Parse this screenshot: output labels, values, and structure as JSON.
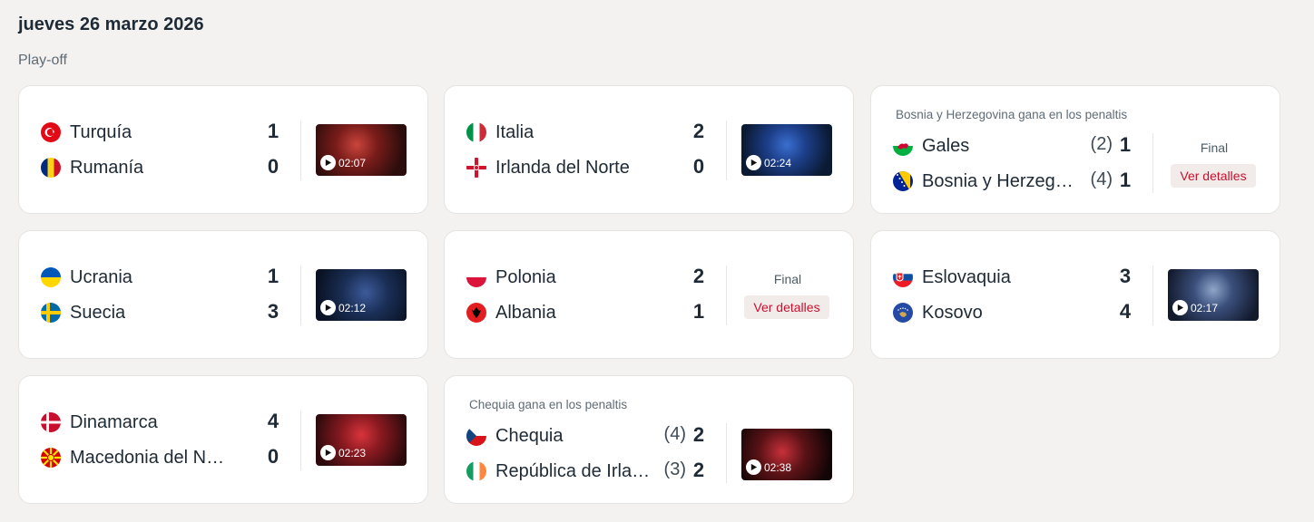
{
  "header": {
    "date": "jueves 26 marzo 2026",
    "stage": "Play-off"
  },
  "matches": [
    {
      "note": "",
      "home": {
        "name": "Turquía",
        "score": "1",
        "pens": "",
        "flag": "turkey-flag"
      },
      "away": {
        "name": "Rumanía",
        "score": "0",
        "pens": "",
        "flag": "romania-flag"
      },
      "video_duration": "02:07",
      "status": "",
      "details_label": ""
    },
    {
      "note": "",
      "home": {
        "name": "Italia",
        "score": "2",
        "pens": "",
        "flag": "italy-flag"
      },
      "away": {
        "name": "Irlanda del Norte",
        "score": "0",
        "pens": "",
        "flag": "northern-ireland-flag"
      },
      "video_duration": "02:24",
      "status": "",
      "details_label": ""
    },
    {
      "note": "Bosnia y Herzegovina gana en los penaltis",
      "home": {
        "name": "Gales",
        "score": "1",
        "pens": "(2)",
        "flag": "wales-flag"
      },
      "away": {
        "name": "Bosnia y Herzegovina",
        "score": "1",
        "pens": "(4)",
        "flag": "bosnia-flag"
      },
      "video_duration": "",
      "status": "Final",
      "details_label": "Ver detalles"
    },
    {
      "note": "",
      "home": {
        "name": "Ucrania",
        "score": "1",
        "pens": "",
        "flag": "ukraine-flag"
      },
      "away": {
        "name": "Suecia",
        "score": "3",
        "pens": "",
        "flag": "sweden-flag"
      },
      "video_duration": "02:12",
      "status": "",
      "details_label": ""
    },
    {
      "note": "",
      "home": {
        "name": "Polonia",
        "score": "2",
        "pens": "",
        "flag": "poland-flag"
      },
      "away": {
        "name": "Albania",
        "score": "1",
        "pens": "",
        "flag": "albania-flag"
      },
      "video_duration": "",
      "status": "Final",
      "details_label": "Ver detalles"
    },
    {
      "note": "",
      "home": {
        "name": "Eslovaquia",
        "score": "3",
        "pens": "",
        "flag": "slovakia-flag"
      },
      "away": {
        "name": "Kosovo",
        "score": "4",
        "pens": "",
        "flag": "kosovo-flag"
      },
      "video_duration": "02:17",
      "status": "",
      "details_label": ""
    },
    {
      "note": "",
      "home": {
        "name": "Dinamarca",
        "score": "4",
        "pens": "",
        "flag": "denmark-flag"
      },
      "away": {
        "name": "Macedonia del Norte",
        "score": "0",
        "pens": "",
        "flag": "north-macedonia-flag"
      },
      "video_duration": "02:23",
      "status": "",
      "details_label": ""
    },
    {
      "note": "Chequia gana en los penaltis",
      "home": {
        "name": "Chequia",
        "score": "2",
        "pens": "(4)",
        "flag": "czechia-flag"
      },
      "away": {
        "name": "República de Irlanda",
        "score": "2",
        "pens": "(3)",
        "flag": "ireland-flag"
      },
      "video_duration": "02:38",
      "status": "",
      "details_label": ""
    }
  ]
}
